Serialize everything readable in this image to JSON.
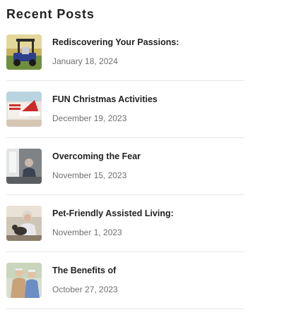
{
  "widget": {
    "title": "Recent Posts"
  },
  "posts": [
    {
      "title": "Rediscovering Your Passions:",
      "date": "January 18, 2024",
      "image": "golf-cart-photo"
    },
    {
      "title": "FUN Christmas Activities",
      "date": "December 19, 2023",
      "image": "santa-hat-photo"
    },
    {
      "title": "Overcoming the Fear",
      "date": "November 15, 2023",
      "image": "senior-by-window-photo"
    },
    {
      "title": "Pet-Friendly Assisted Living:",
      "date": "November 1, 2023",
      "image": "senior-with-cat-photo"
    },
    {
      "title": "The Benefits of",
      "date": "October 27, 2023",
      "image": "senior-couple-photo"
    }
  ]
}
